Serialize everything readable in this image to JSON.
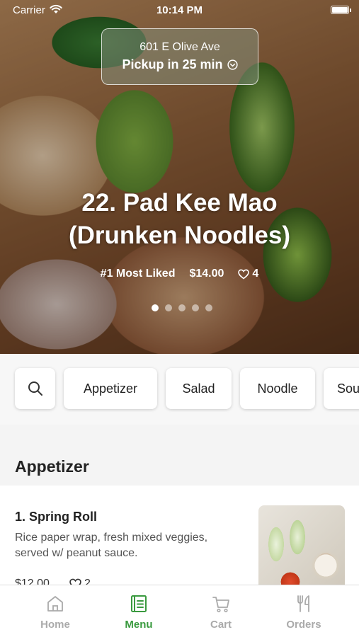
{
  "status_bar": {
    "carrier": "Carrier",
    "time": "10:14 PM"
  },
  "location": {
    "address": "601 E Olive Ave",
    "pickup": "Pickup in 25 min"
  },
  "featured": {
    "title_line1": "22. Pad Kee Mao",
    "title_line2": "(Drunken Noodles)",
    "badge": "#1 Most Liked",
    "price": "$14.00",
    "likes": "4",
    "page_count": 5,
    "active_page": 1
  },
  "categories": [
    "Appetizer",
    "Salad",
    "Noodle",
    "Sou"
  ],
  "section": {
    "title": "Appetizer"
  },
  "menu_items": [
    {
      "name": "1. Spring Roll",
      "description": "Rice paper wrap, fresh mixed veggies, served w/ peanut sauce.",
      "price": "$12.00",
      "likes": "2"
    }
  ],
  "tabs": [
    {
      "label": "Home",
      "icon": "home-icon",
      "active": false
    },
    {
      "label": "Menu",
      "icon": "menu-book-icon",
      "active": true
    },
    {
      "label": "Cart",
      "icon": "cart-icon",
      "active": false
    },
    {
      "label": "Orders",
      "icon": "fork-knife-icon",
      "active": false
    }
  ],
  "colors": {
    "accent": "#3a9a3f",
    "inactive_tab": "#aaaaaa"
  }
}
